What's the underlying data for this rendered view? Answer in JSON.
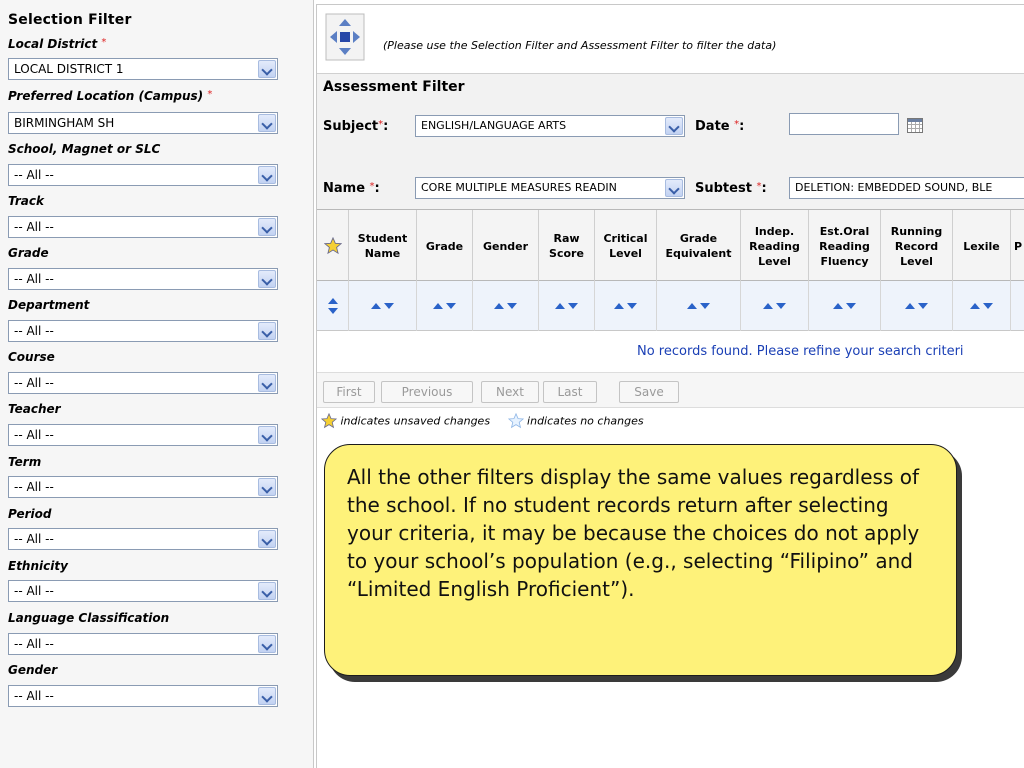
{
  "left_panel": {
    "title": "Selection Filter",
    "required_mark": "*",
    "filters": [
      {
        "label": "Local District",
        "required": true,
        "value": "LOCAL DISTRICT 1"
      },
      {
        "label": "Preferred Location (Campus)",
        "required": true,
        "value": "BIRMINGHAM SH"
      },
      {
        "label": "School, Magnet or SLC",
        "required": false,
        "value": "-- All --"
      },
      {
        "label": "Track",
        "required": false,
        "value": "-- All --"
      },
      {
        "label": "Grade",
        "required": false,
        "value": "-- All --"
      },
      {
        "label": "Department",
        "required": false,
        "value": "-- All --"
      },
      {
        "label": "Course",
        "required": false,
        "value": "-- All --"
      },
      {
        "label": "Teacher",
        "required": false,
        "value": "-- All --"
      },
      {
        "label": "Term",
        "required": false,
        "value": "-- All --"
      },
      {
        "label": "Period",
        "required": false,
        "value": "-- All --"
      },
      {
        "label": "Ethnicity",
        "required": false,
        "value": "-- All --"
      },
      {
        "label": "Language Classification",
        "required": false,
        "value": "-- All --"
      },
      {
        "label": "Gender",
        "required": false,
        "value": "-- All --"
      }
    ]
  },
  "info": {
    "icon": "move-arrows-icon",
    "text": "(Please use the Selection Filter and Assessment Filter to filter the data)"
  },
  "assessment_filter": {
    "title": "Assessment Filter",
    "subject_label": "Subject",
    "subject_value": "ENGLISH/LANGUAGE ARTS",
    "date_label": "Date",
    "date_value": "",
    "name_label": "Name",
    "name_value": "CORE MULTIPLE MEASURES READIN",
    "subtest_label": "Subtest",
    "subtest_value": "DELETION: EMBEDDED SOUND, BLE",
    "colon": ":"
  },
  "grid": {
    "columns": [
      "Student Name",
      "Grade",
      "Gender",
      "Raw Score",
      "Critical Level",
      "Grade Equivalent",
      "Indep. Reading Level",
      "Est.Oral Reading Fluency",
      "Running Record Level",
      "Lexile",
      "P"
    ],
    "empty_message": "No records found. Please refine your search criteri"
  },
  "pager": {
    "first": "First",
    "previous": "Previous",
    "next": "Next",
    "last": "Last",
    "save": "Save"
  },
  "legend": {
    "unsaved": "indicates unsaved changes",
    "nochange": "indicates no changes"
  },
  "callout": {
    "text": "All the other filters display the same values regardless of the school. If no student records return after selecting your criteria, it may be because the choices do not apply to your school’s population (e.g., selecting “Filipino” and “Limited English Proficient”)."
  },
  "colors": {
    "callout_bg": "#fef27a",
    "link_blue": "#1a3fb5",
    "required_red": "#d22222"
  }
}
